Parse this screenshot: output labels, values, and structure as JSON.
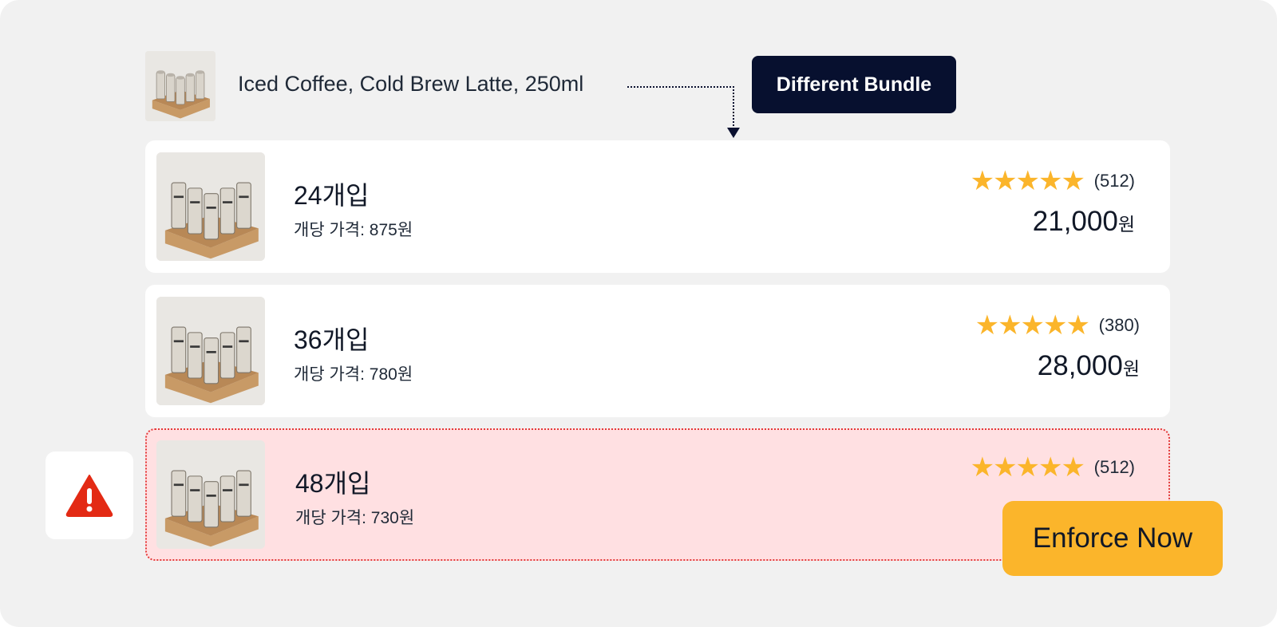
{
  "header": {
    "title": "Iced Coffee, Cold Brew Latte, 250ml",
    "tag": "Different Bundle",
    "thumb_icon": "cold-brew-pack-image"
  },
  "listings": [
    {
      "count": "24개입",
      "unit_price": "개당 가격: 875원",
      "rating_stars": "★★★★★",
      "reviews": "(512)",
      "price": "21,000",
      "currency": "원",
      "flagged": false
    },
    {
      "count": "36개입",
      "unit_price": "개당 가격: 780원",
      "rating_stars": "★★★★★",
      "reviews": "(380)",
      "price": "28,000",
      "currency": "원",
      "flagged": false
    },
    {
      "count": "48개입",
      "unit_price": "개당 가격: 730원",
      "rating_stars": "★★★★★",
      "reviews": "(512)",
      "flagged": true
    }
  ],
  "action": {
    "enforce_label": "Enforce Now"
  },
  "warning_icon": "warning-triangle-icon",
  "colors": {
    "background": "#f1f1f1",
    "tag_bg": "#07102f",
    "star": "#fbb52b",
    "flag_bg": "#ffe0e2",
    "flag_border": "#e33a3a",
    "warning": "#e32a14",
    "button": "#fbb52b"
  }
}
